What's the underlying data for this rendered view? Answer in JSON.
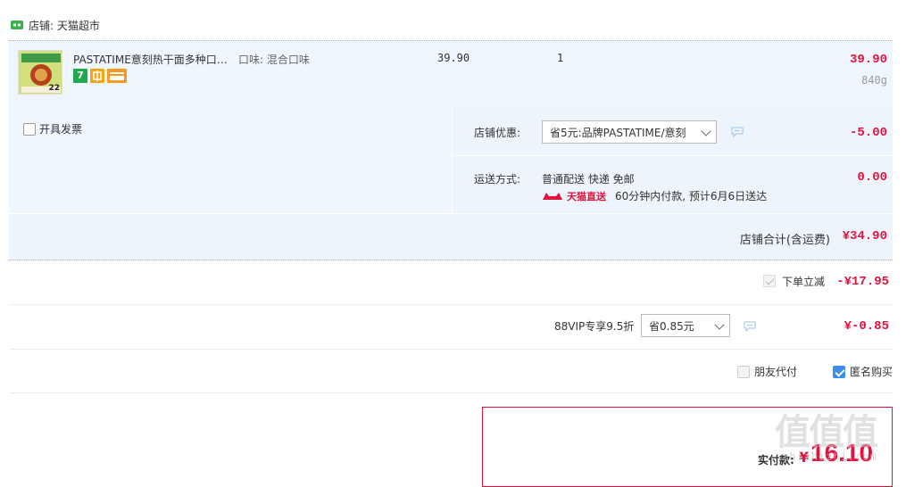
{
  "shop": {
    "label": "店铺: 天猫超市"
  },
  "item": {
    "title": "PASTATIME意刻热干面多种口…",
    "taste": "口味: 混合口味",
    "unit_price": "39.90",
    "quantity": "1",
    "total": "39.90",
    "weight": "840g",
    "thumb_text": "22",
    "badge_seven": "7"
  },
  "invoice": {
    "label": "开具发票"
  },
  "shop_discount": {
    "label": "店铺优惠:",
    "selected": "省5元:品牌PASTATIME/意刻",
    "value": "-5.00"
  },
  "shipping": {
    "label": "运送方式:",
    "method": "普通配送 快递 免邮",
    "badge": "天猫直送",
    "note": "60分钟内付款, 预计6月6日送达",
    "value": "0.00"
  },
  "shop_total": {
    "label": "店铺合计(含运费)",
    "value": "¥34.90"
  },
  "instant_discount": {
    "label": "下单立减",
    "value": "-¥17.95"
  },
  "vip": {
    "label": "88VIP专享9.5折",
    "selected": "省0.85元",
    "value": "¥-0.85"
  },
  "options": {
    "friend_pay": "朋友代付",
    "anonymous": "匿名购买"
  },
  "payment": {
    "label": "实付款:",
    "currency": "¥",
    "amount": "16.10"
  },
  "watermark": {
    "main": "值值值",
    "sub": "zhizhizhi.com"
  },
  "colors": {
    "accent_red": "#e4123e",
    "checkbox_blue": "#3a8cf0",
    "row_bg": "#f0f6fe"
  }
}
